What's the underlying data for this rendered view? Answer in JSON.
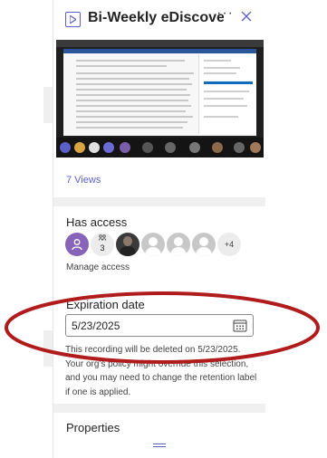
{
  "header": {
    "title": "Bi-Weekly eDiscovery & ...",
    "file_icon": "video-file-icon",
    "more_icon": "more-icon",
    "close_icon": "close-icon"
  },
  "views": {
    "label": "7 Views"
  },
  "access": {
    "title": "Has access",
    "group_count": "3",
    "more_count": "+4",
    "manage_label": "Manage access"
  },
  "expiration": {
    "title": "Expiration date",
    "date_value": "5/23/2025",
    "calendar_icon": "calendar-icon",
    "description": "This recording will be deleted on 5/23/2025. Your org's policy might override this selection, and you may need to change the retention label if one is applied."
  },
  "properties": {
    "title": "Properties"
  },
  "colors": {
    "accent": "#5b5fc7",
    "user_avatar": "#8764b8",
    "annotation_ring": "#b01b1b"
  }
}
